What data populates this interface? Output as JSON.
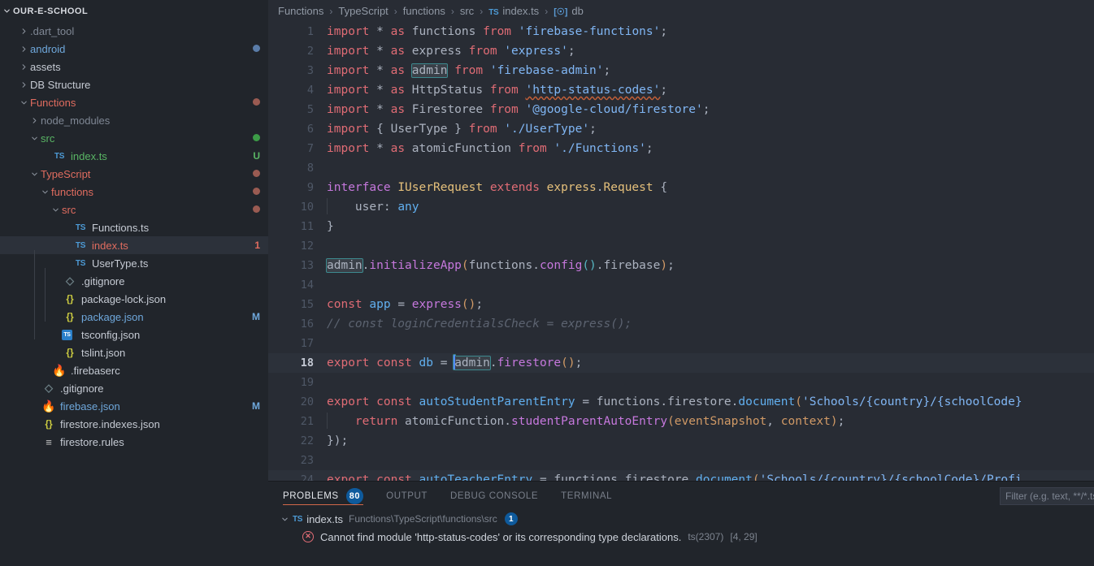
{
  "sidebar": {
    "project_name": "OUR-E-SCHOOL",
    "items": [
      {
        "label": ".dart_tool",
        "indent": 1,
        "kind": "folder",
        "state": "collapsed",
        "icon": "chevron-right-icon",
        "color": "#7f8794",
        "decoration": "",
        "decoration_color": "",
        "selected": false
      },
      {
        "label": "android",
        "indent": 1,
        "kind": "folder",
        "state": "collapsed",
        "icon": "chevron-right-icon",
        "color": "#6fa8dc",
        "decoration": "dot",
        "decoration_color": "#5a7ca8",
        "selected": false
      },
      {
        "label": "assets",
        "indent": 1,
        "kind": "folder",
        "state": "collapsed",
        "icon": "chevron-right-icon",
        "color": "#c5cad3",
        "decoration": "",
        "decoration_color": "",
        "selected": false
      },
      {
        "label": "DB Structure",
        "indent": 1,
        "kind": "folder",
        "state": "collapsed",
        "icon": "chevron-right-icon",
        "color": "#c5cad3",
        "decoration": "",
        "decoration_color": "",
        "selected": false
      },
      {
        "label": "Functions",
        "indent": 1,
        "kind": "folder",
        "state": "expanded",
        "icon": "chevron-down-icon",
        "color": "#e06c5f",
        "decoration": "dot",
        "decoration_color": "#9a5b52",
        "selected": false
      },
      {
        "label": "node_modules",
        "indent": 2,
        "kind": "folder",
        "state": "collapsed",
        "icon": "chevron-right-icon",
        "color": "#7f8794",
        "decoration": "",
        "decoration_color": "",
        "selected": false
      },
      {
        "label": "src",
        "indent": 2,
        "kind": "folder",
        "state": "expanded",
        "icon": "chevron-down-icon",
        "color": "#59b564",
        "decoration": "dot",
        "decoration_color": "#3c9c47",
        "selected": false
      },
      {
        "label": "index.ts",
        "indent": 3,
        "kind": "file",
        "state": "",
        "icon": "ts-file-icon",
        "color": "#59b564",
        "decoration": "U",
        "decoration_color": "#59b564",
        "selected": false
      },
      {
        "label": "TypeScript",
        "indent": 2,
        "kind": "folder",
        "state": "expanded",
        "icon": "chevron-down-icon",
        "color": "#e06c5f",
        "decoration": "dot",
        "decoration_color": "#9a5b52",
        "selected": false
      },
      {
        "label": "functions",
        "indent": 3,
        "kind": "folder",
        "state": "expanded",
        "icon": "chevron-down-icon",
        "color": "#e06c5f",
        "decoration": "dot",
        "decoration_color": "#9a5b52",
        "selected": false
      },
      {
        "label": "src",
        "indent": 4,
        "kind": "folder",
        "state": "expanded",
        "icon": "chevron-down-icon",
        "color": "#e06c5f",
        "decoration": "dot",
        "decoration_color": "#9a5b52",
        "selected": false
      },
      {
        "label": "Functions.ts",
        "indent": 5,
        "kind": "file",
        "state": "",
        "icon": "ts-file-icon",
        "color": "#c5cad3",
        "decoration": "",
        "decoration_color": "",
        "selected": false
      },
      {
        "label": "index.ts",
        "indent": 5,
        "kind": "file",
        "state": "",
        "icon": "ts-file-icon",
        "color": "#e06c5f",
        "decoration": "1",
        "decoration_color": "#e06c5f",
        "selected": true
      },
      {
        "label": "UserType.ts",
        "indent": 5,
        "kind": "file",
        "state": "",
        "icon": "ts-file-icon",
        "color": "#c5cad3",
        "decoration": "",
        "decoration_color": "",
        "selected": false
      },
      {
        "label": ".gitignore",
        "indent": 4,
        "kind": "file",
        "state": "",
        "icon": "git-file-icon",
        "color": "#c5cad3",
        "decoration": "",
        "decoration_color": "",
        "selected": false
      },
      {
        "label": "package-lock.json",
        "indent": 4,
        "kind": "file",
        "state": "",
        "icon": "json-file-icon",
        "color": "#c5cad3",
        "decoration": "",
        "decoration_color": "",
        "selected": false
      },
      {
        "label": "package.json",
        "indent": 4,
        "kind": "file",
        "state": "",
        "icon": "json-file-icon",
        "color": "#6fa8dc",
        "decoration": "M",
        "decoration_color": "#6fa8dc",
        "selected": false
      },
      {
        "label": "tsconfig.json",
        "indent": 4,
        "kind": "file",
        "state": "",
        "icon": "tsconfig-file-icon",
        "color": "#c5cad3",
        "decoration": "",
        "decoration_color": "",
        "selected": false
      },
      {
        "label": "tslint.json",
        "indent": 4,
        "kind": "file",
        "state": "",
        "icon": "json-file-icon",
        "color": "#c5cad3",
        "decoration": "",
        "decoration_color": "",
        "selected": false
      },
      {
        "label": ".firebaserc",
        "indent": 3,
        "kind": "file",
        "state": "",
        "icon": "firebase-file-icon",
        "color": "#c5cad3",
        "decoration": "",
        "decoration_color": "",
        "selected": false
      },
      {
        "label": ".gitignore",
        "indent": 2,
        "kind": "file",
        "state": "",
        "icon": "git-file-icon",
        "color": "#c5cad3",
        "decoration": "",
        "decoration_color": "",
        "selected": false
      },
      {
        "label": "firebase.json",
        "indent": 2,
        "kind": "file",
        "state": "",
        "icon": "firebase-file-icon",
        "color": "#6fa8dc",
        "decoration": "M",
        "decoration_color": "#6fa8dc",
        "selected": false
      },
      {
        "label": "firestore.indexes.json",
        "indent": 2,
        "kind": "file",
        "state": "",
        "icon": "json-file-icon",
        "color": "#c5cad3",
        "decoration": "",
        "decoration_color": "",
        "selected": false
      },
      {
        "label": "firestore.rules",
        "indent": 2,
        "kind": "file",
        "state": "",
        "icon": "rules-file-icon",
        "color": "#c5cad3",
        "decoration": "",
        "decoration_color": "",
        "selected": false
      }
    ]
  },
  "breadcrumb": {
    "items": [
      {
        "label": "Functions",
        "icon": ""
      },
      {
        "label": "TypeScript",
        "icon": ""
      },
      {
        "label": "functions",
        "icon": ""
      },
      {
        "label": "src",
        "icon": ""
      },
      {
        "label": "index.ts",
        "icon": "ts-file-icon"
      },
      {
        "label": "db",
        "icon": "variable-symbol-icon"
      }
    ],
    "separator": "›"
  },
  "editor": {
    "active_line": 18,
    "lines": [
      {
        "n": 1,
        "text": "import * as functions from 'firebase-functions';"
      },
      {
        "n": 2,
        "text": "import * as express from 'express';"
      },
      {
        "n": 3,
        "text": "import * as admin from 'firebase-admin';"
      },
      {
        "n": 4,
        "text": "import * as HttpStatus from 'http-status-codes';"
      },
      {
        "n": 5,
        "text": "import * as Firestoree from '@google-cloud/firestore';"
      },
      {
        "n": 6,
        "text": "import { UserType } from './UserType';"
      },
      {
        "n": 7,
        "text": "import * as atomicFunction from './Functions';"
      },
      {
        "n": 8,
        "text": ""
      },
      {
        "n": 9,
        "text": "interface IUserRequest extends express.Request {"
      },
      {
        "n": 10,
        "text": "    user: any"
      },
      {
        "n": 11,
        "text": "}"
      },
      {
        "n": 12,
        "text": ""
      },
      {
        "n": 13,
        "text": "admin.initializeApp(functions.config().firebase);"
      },
      {
        "n": 14,
        "text": ""
      },
      {
        "n": 15,
        "text": "const app = express();"
      },
      {
        "n": 16,
        "text": "// const loginCredentialsCheck = express();"
      },
      {
        "n": 17,
        "text": ""
      },
      {
        "n": 18,
        "text": "export const db = admin.firestore();"
      },
      {
        "n": 19,
        "text": ""
      },
      {
        "n": 20,
        "text": "export const autoStudentParentEntry = functions.firestore.document('Schools/{country}/{schoolCode}"
      },
      {
        "n": 21,
        "text": "    return atomicFunction.studentParentAutoEntry(eventSnapshot, context);"
      },
      {
        "n": 22,
        "text": "});"
      },
      {
        "n": 23,
        "text": ""
      },
      {
        "n": 24,
        "text": "export const autoTeacherEntry = functions.firestore.document('Schools/{country}/{schoolCode}/Profi"
      }
    ]
  },
  "panel": {
    "tabs": [
      {
        "label": "PROBLEMS",
        "badge": "80",
        "active": true
      },
      {
        "label": "OUTPUT",
        "badge": "",
        "active": false
      },
      {
        "label": "DEBUG CONSOLE",
        "badge": "",
        "active": false
      },
      {
        "label": "TERMINAL",
        "badge": "",
        "active": false
      }
    ],
    "filter_placeholder": "Filter (e.g. text, **/*.ts, !**/node_modules/**)",
    "filter_value": "",
    "problems": [
      {
        "file": "index.ts",
        "path": "Functions\\TypeScript\\functions\\src",
        "count": "1",
        "expanded": true,
        "entries": [
          {
            "severity": "error",
            "message": "Cannot find module 'http-status-codes' or its corresponding type declarations.",
            "code": "ts(2307)",
            "position": "[4, 29]"
          }
        ]
      }
    ]
  },
  "colors": {
    "sidebar_bg": "#21252b",
    "editor_bg": "#282c34",
    "accent": "#0e5a9c",
    "error": "#e06c75",
    "active_tab_underline": "#d1684a"
  }
}
